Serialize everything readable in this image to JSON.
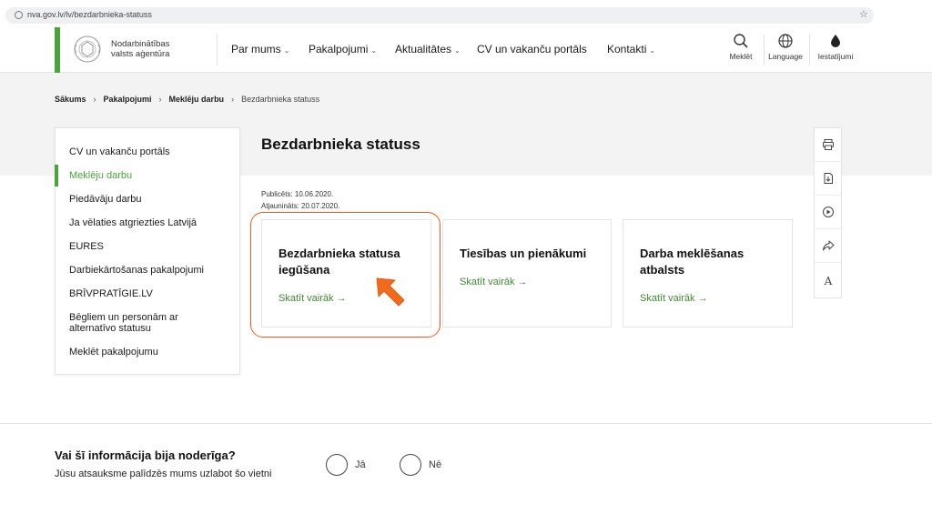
{
  "browser": {
    "url": "nva.gov.lv/lv/bezdarbnieka-statuss"
  },
  "header": {
    "logo_text": "Nodarbinātības valsts aģentūra",
    "nav": [
      "Par mums",
      "Pakalpojumi",
      "Aktualitātes",
      "CV un vakanču portāls",
      "Kontakti"
    ],
    "tools": [
      "Meklēt",
      "Language",
      "Iestatījumi"
    ]
  },
  "breadcrumb": [
    "Sākums",
    "Pakalpojumi",
    "Meklēju darbu",
    "Bezdarbnieka statuss"
  ],
  "sidebar": {
    "items": [
      "CV un vakanču portāls",
      "Meklēju darbu",
      "Piedāvāju darbu",
      "Ja vēlaties atgriezties Latvijā",
      "EURES",
      "Darbiekārtošanas pakalpojumi",
      "BRĪVPRATĪGIE.LV",
      "Bēgliem un personām ar alternatīvo statusu",
      "Meklēt pakalpojumu"
    ]
  },
  "main": {
    "title": "Bezdarbnieka statuss",
    "published": "Publicēts: 10.06.2020.",
    "updated": "Atjaunināts: 20.07.2020.",
    "cards": [
      {
        "title": "Bezdarbnieka statusa iegūšana",
        "link": "Skatīt vairāk →"
      },
      {
        "title": "Tiesības un pienākumi",
        "link": "Skatīt vairāk →"
      },
      {
        "title": "Darba meklēšanas atbalsts",
        "link": "Skatīt vairāk →"
      }
    ]
  },
  "feedback": {
    "question": "Vai šī informācija bija noderīga?",
    "subtitle": "Jūsu atsauksme palīdzēs mums uzlabot šo vietni",
    "yes": "Jā",
    "no": "Nē"
  },
  "colors": {
    "accent": "#4aa33b",
    "highlight": "#f05a22"
  }
}
